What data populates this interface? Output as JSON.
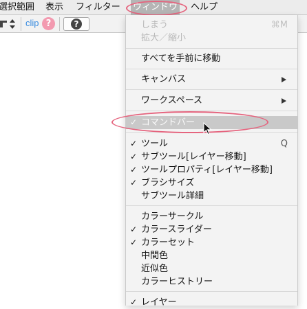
{
  "menubar": {
    "items": [
      {
        "label": "選択範囲"
      },
      {
        "label": "表示"
      },
      {
        "label": "フィルター"
      },
      {
        "label": "ウィンドウ",
        "active": true
      },
      {
        "label": "ヘルプ"
      }
    ]
  },
  "toolbar": {
    "clip_label": "clip",
    "help_badge": "?",
    "help_button": "?"
  },
  "window_menu": {
    "close": {
      "label": "しまう",
      "shortcut": "⌘M"
    },
    "zoom": {
      "label": "拡大／縮小"
    },
    "bring_all": {
      "label": "すべてを手前に移動"
    },
    "canvas": {
      "label": "キャンバス"
    },
    "workspace": {
      "label": "ワークスペース"
    },
    "command_bar": {
      "label": "コマンドバー",
      "checked": true
    },
    "tool": {
      "label": "ツール",
      "shortcut": "Q",
      "checked": true
    },
    "sub_tool": {
      "label": "サブツール[レイヤー移動]",
      "checked": true
    },
    "tool_property": {
      "label": "ツールプロパティ[レイヤー移動]",
      "checked": true
    },
    "brush_size": {
      "label": "ブラシサイズ",
      "checked": true
    },
    "sub_tool_detail": {
      "label": "サブツール詳細",
      "checked": false
    },
    "color_circle": {
      "label": "カラーサークル",
      "checked": false
    },
    "color_slider": {
      "label": "カラースライダー",
      "checked": true
    },
    "color_set": {
      "label": "カラーセット",
      "checked": true
    },
    "intermediate_color": {
      "label": "中間色",
      "checked": false
    },
    "approx_color": {
      "label": "近似色",
      "checked": false
    },
    "color_history": {
      "label": "カラーヒストリー",
      "checked": false
    },
    "layer": {
      "label": "レイヤー",
      "checked": true
    }
  },
  "checkmark": "✓",
  "colors": {
    "highlight_ellipse": "#e5647e",
    "clip_blue": "#3a8ce0",
    "help_pink": "#f39ab0"
  }
}
